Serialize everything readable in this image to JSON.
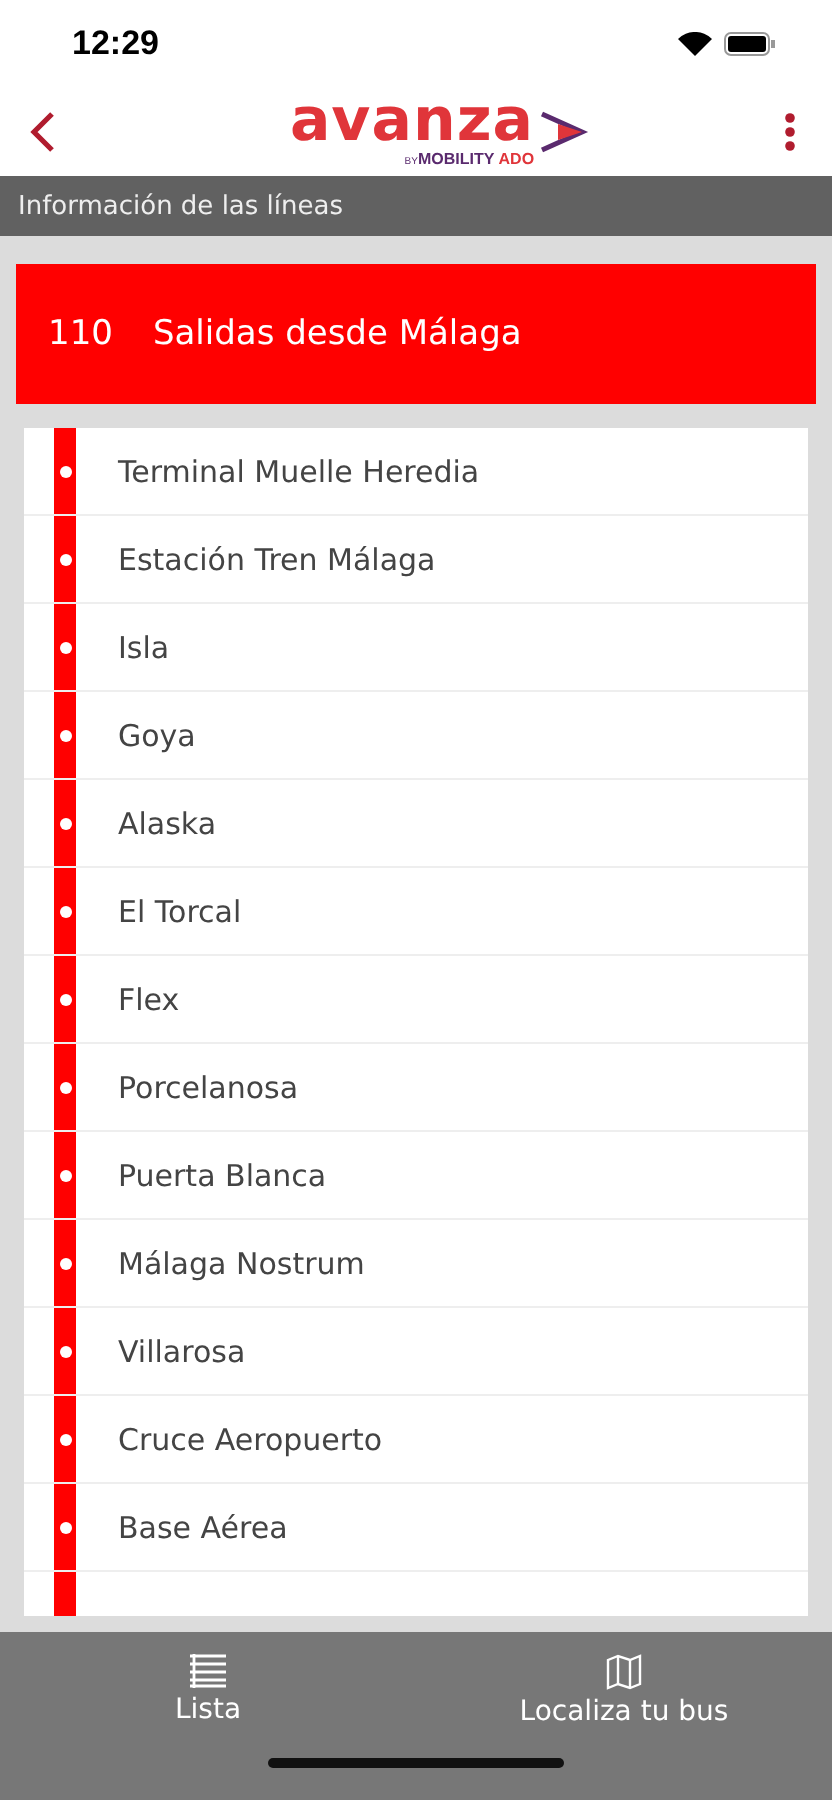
{
  "status_bar": {
    "time": "12:29"
  },
  "header": {
    "logo": {
      "brand": "avanza",
      "byline_prefix": "BY",
      "byline_main": "MOBILITY",
      "byline_accent": "ADO"
    }
  },
  "section_bar": {
    "title": "Información de las líneas"
  },
  "line": {
    "number": "110",
    "title": "Salidas desde Málaga"
  },
  "stops": [
    {
      "name": "Terminal Muelle Heredia"
    },
    {
      "name": "Estación Tren Málaga"
    },
    {
      "name": "Isla"
    },
    {
      "name": "Goya"
    },
    {
      "name": "Alaska"
    },
    {
      "name": "El Torcal"
    },
    {
      "name": "Flex"
    },
    {
      "name": "Porcelanosa"
    },
    {
      "name": "Puerta Blanca"
    },
    {
      "name": "Málaga Nostrum"
    },
    {
      "name": "Villarosa"
    },
    {
      "name": "Cruce Aeropuerto"
    },
    {
      "name": "Base Aérea"
    }
  ],
  "tab_bar": [
    {
      "kind": "list",
      "label": "Lista"
    },
    {
      "kind": "map",
      "label": "Localiza tu bus"
    }
  ]
}
